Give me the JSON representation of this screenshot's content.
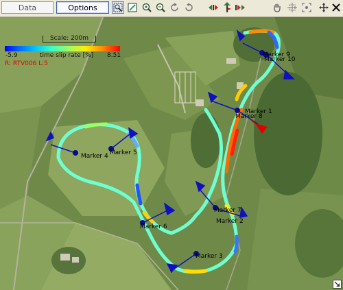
{
  "tabs": [
    {
      "label": "Data",
      "active": false
    },
    {
      "label": "Options",
      "active": true
    }
  ],
  "toolbar_icons": [
    "zoom-area-icon",
    "edit-icon",
    "zoom-in-icon",
    "zoom-out-icon",
    "rotate-left-icon",
    "rotate-right-icon",
    "step-back-icon",
    "marker-up-icon",
    "step-forward-icon",
    "pan-hand-icon",
    "fit-view-icon",
    "zoom-extents-icon",
    "expand-icon",
    "close-icon"
  ],
  "map": {
    "scale_label": "Scale: 200m",
    "legend": {
      "min": "-5.9",
      "max": "8.51",
      "label": "time slip rate [%]"
    },
    "run_info": "R: RTV006  L:5",
    "markers": [
      {
        "label": "Marker 1"
      },
      {
        "label": "Marker 2"
      },
      {
        "label": "Marker 3"
      },
      {
        "label": "Marker 4"
      },
      {
        "label": "Marker 5"
      },
      {
        "label": "Marker 6"
      },
      {
        "label": "Marker 7"
      },
      {
        "label": "Marker 8"
      },
      {
        "label": "Marker 9"
      },
      {
        "label": "Marker 10"
      }
    ]
  }
}
